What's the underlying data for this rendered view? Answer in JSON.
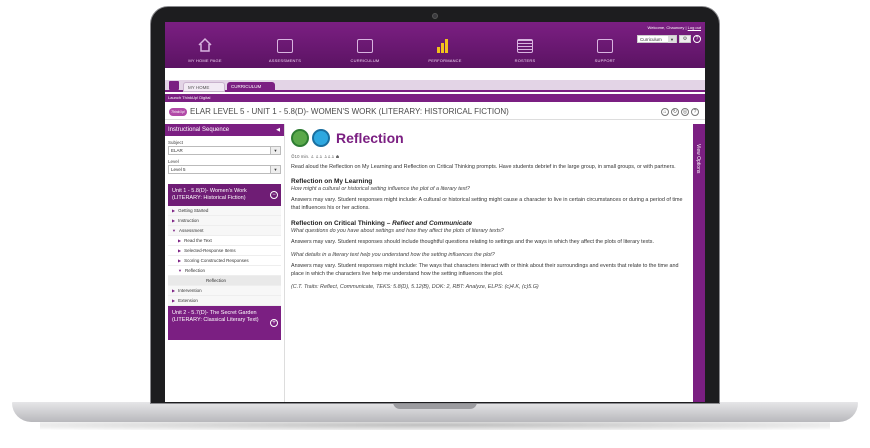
{
  "topnav": {
    "items": [
      {
        "label": "MY HOME PAGE",
        "icon": "house-icon"
      },
      {
        "label": "ASSESSMENTS",
        "icon": "assessment-icon"
      },
      {
        "label": "CURRICULUM",
        "icon": "book-icon"
      },
      {
        "label": "PERFORMANCE",
        "icon": "bar-chart-icon"
      },
      {
        "label": "ROSTERS",
        "icon": "roster-icon"
      },
      {
        "label": "SUPPORT",
        "icon": "monitor-icon"
      }
    ],
    "welcome": "Welcome, Chauncey |",
    "logout": "Log out",
    "selector": "Curriculum"
  },
  "tabs": {
    "home": "MY HOME PAGE",
    "active": "CURRICULUM",
    "launch": "Launch ThinkUp! Digital"
  },
  "crumb": {
    "brand": "ThinkUp!",
    "text": "ELAR LEVEL 5 - UNIT 1 - 5.8(D)- WOMEN'S WORK (LITERARY: HISTORICAL FICTION)"
  },
  "sidebar": {
    "header": "Instructional Sequence",
    "subject_label": "Subject",
    "subject_value": "ELAR",
    "level_label": "Level",
    "level_value": "Level 5",
    "unit1": "Unit 1 - 5.8(D)- Women's Work (LITERARY: Historical Fiction)",
    "items": [
      "Getting Started",
      "Instruction",
      "Assessment",
      "Read the Text",
      "Selected-Response Items",
      "Scoring Constructed Responses",
      "Reflection",
      "Reflection",
      "Intervention",
      "Extension"
    ],
    "unit2": "Unit 2 - 5.7(D)- The Secret Garden (LITERARY: Classical Literary Text)"
  },
  "main": {
    "title": "Reflection",
    "meta": "⏱10 min.  ♙  ♙♙ ♙♙♙ ☗",
    "intro": "Read aloud the Reflection on My Learning and Reflection on Critical Thinking prompts. Have students debrief in the large group, in small groups, or with partners.",
    "h1": "Reflection on My Learning",
    "q1": "How might a cultural or historical setting influence the plot of a literary text?",
    "a1": "Answers may vary. Student responses might include: A cultural or historical setting might cause a character to live in certain circumstances or during a period of time that influences his or her actions.",
    "h2a": "Reflection on Critical Thinking – ",
    "h2b": "Reflect and Communicate",
    "q2": "What questions do you have about settings and how they affect the plots of literary texts?",
    "a2": "Answers may vary. Student responses should include thoughtful questions relating to settings and the ways in which they affect the plots of literary texts.",
    "q3": "What details in a literary text help you understand how the setting influences the plot?",
    "a3": "Answers may vary. Student responses might include: The ways that characters interact with or think about their surroundings and events that relate to the time and place in which the characters live help me understand how the setting influences the plot.",
    "tags": "(C.T. Traits: Reflect, Communicate, TEKS: 5.8(D), 5.12(B), DOK: 2, RBT: Analyze, ELPS: (c)4.K, (c)5.G)"
  },
  "rail": {
    "label": "View Options"
  },
  "colors": {
    "brand": "#7b1f82",
    "accent": "#f2c11b"
  }
}
